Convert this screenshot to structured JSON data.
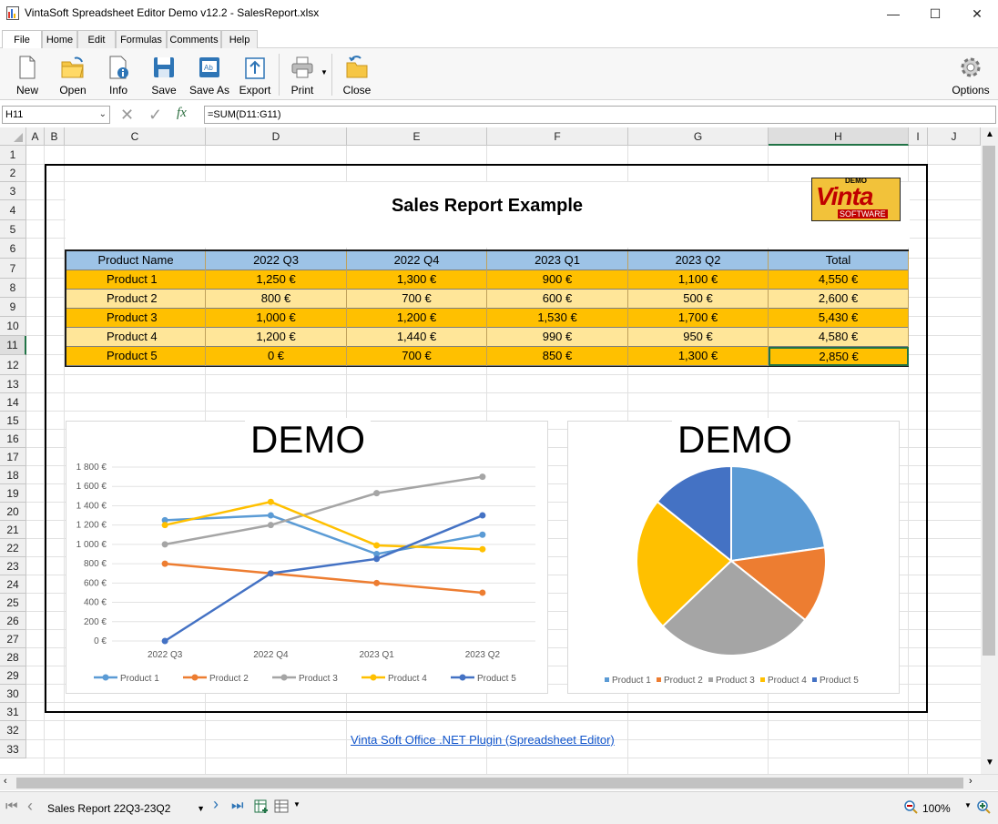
{
  "window": {
    "title": "VintaSoft Spreadsheet Editor Demo v12.2 - SalesReport.xlsx",
    "minimize": "—",
    "maximize": "☐",
    "close": "✕"
  },
  "menu_tabs": [
    "File",
    "Home",
    "Edit",
    "Formulas",
    "Comments",
    "Help"
  ],
  "ribbon": {
    "new": "New",
    "open": "Open",
    "info": "Info",
    "save": "Save",
    "save_as": "Save As",
    "export": "Export",
    "print": "Print",
    "close": "Close",
    "options": "Options"
  },
  "formula_bar": {
    "name_box": "H11",
    "formula": "=SUM(D11:G11)",
    "fx": "fx"
  },
  "columns": [
    "A",
    "B",
    "C",
    "D",
    "E",
    "F",
    "G",
    "H",
    "I",
    "J"
  ],
  "rows": [
    "1",
    "2",
    "3",
    "4",
    "5",
    "6",
    "7",
    "8",
    "9",
    "10",
    "11",
    "12",
    "13",
    "14",
    "15",
    "16",
    "17",
    "18",
    "19",
    "20",
    "21",
    "22",
    "23",
    "24",
    "25",
    "26",
    "27",
    "28",
    "29",
    "30",
    "31",
    "32",
    "33"
  ],
  "report": {
    "title": "Sales Report Example",
    "logo_small": "DEMO",
    "logo_main": "Vinta",
    "logo_sub": "SOFTWARE",
    "headers": [
      "Product Name",
      "2022 Q3",
      "2022 Q4",
      "2023 Q1",
      "2023 Q2",
      "Total"
    ],
    "rows": [
      [
        "Product 1",
        "1,250 €",
        "1,300 €",
        "900 €",
        "1,100 €",
        "4,550 €"
      ],
      [
        "Product 2",
        "800 €",
        "700 €",
        "600 €",
        "500 €",
        "2,600 €"
      ],
      [
        "Product 3",
        "1,000 €",
        "1,200 €",
        "1,530 €",
        "1,700 €",
        "5,430 €"
      ],
      [
        "Product 4",
        "1,200 €",
        "1,440 €",
        "990 €",
        "950 €",
        "4,580 €"
      ],
      [
        "Product 5",
        "0 €",
        "700 €",
        "850 €",
        "1,300 €",
        "2,850 €"
      ]
    ],
    "colors": {
      "header": "#9dc3e6",
      "odd": "#ffc000",
      "even": "#ffe699"
    }
  },
  "chart_data": [
    {
      "type": "line",
      "watermark": "DEMO",
      "categories": [
        "2022 Q3",
        "2022 Q4",
        "2023 Q1",
        "2023 Q2"
      ],
      "y_ticks": [
        "0 €",
        "200 €",
        "400 €",
        "600 €",
        "800 €",
        "1 000 €",
        "1 200 €",
        "1 400 €",
        "1 600 €",
        "1 800 €"
      ],
      "ylim": [
        0,
        1800
      ],
      "legend_position": "bottom",
      "series": [
        {
          "name": "Product 1",
          "values": [
            1250,
            1300,
            900,
            1100
          ],
          "color": "#5b9bd5"
        },
        {
          "name": "Product 2",
          "values": [
            800,
            700,
            600,
            500
          ],
          "color": "#ed7d31"
        },
        {
          "name": "Product 3",
          "values": [
            1000,
            1200,
            1530,
            1700
          ],
          "color": "#a5a5a5"
        },
        {
          "name": "Product 4",
          "values": [
            1200,
            1440,
            990,
            950
          ],
          "color": "#ffc000"
        },
        {
          "name": "Product 5",
          "values": [
            0,
            700,
            850,
            1300
          ],
          "color": "#4472c4"
        }
      ]
    },
    {
      "type": "pie",
      "watermark": "DEMO",
      "legend_position": "bottom",
      "slices": [
        {
          "name": "Product 1",
          "value": 4550,
          "color": "#5b9bd5"
        },
        {
          "name": "Product 2",
          "value": 2600,
          "color": "#ed7d31"
        },
        {
          "name": "Product 3",
          "value": 5430,
          "color": "#a5a5a5"
        },
        {
          "name": "Product 4",
          "value": 4580,
          "color": "#ffc000"
        },
        {
          "name": "Product 5",
          "value": 2850,
          "color": "#4472c4"
        }
      ]
    }
  ],
  "link_text": "Vinta Soft Office .NET Plugin (Spreadsheet Editor)",
  "status": {
    "sheet_name": "Sales Report 22Q3-23Q2",
    "zoom": "100%"
  }
}
